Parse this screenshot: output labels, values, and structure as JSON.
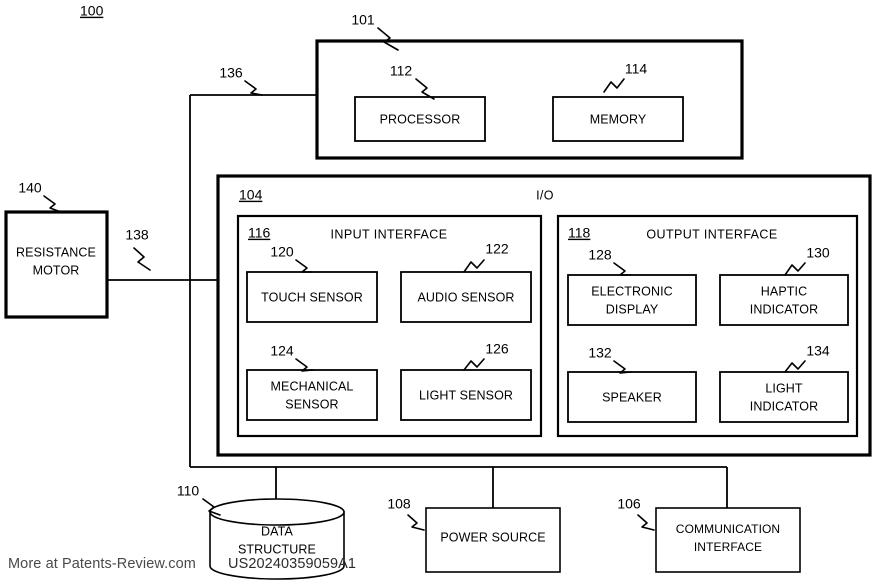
{
  "figure": {
    "id": "100",
    "io_title": "I/O",
    "blocks": {
      "system": {
        "ref": "101"
      },
      "processor": {
        "ref": "112",
        "label": "PROCESSOR"
      },
      "memory": {
        "ref": "114",
        "label": "MEMORY"
      },
      "io": {
        "ref": "104",
        "label": "I/O"
      },
      "input_interface": {
        "ref": "116",
        "label": "INPUT INTERFACE"
      },
      "output_interface": {
        "ref": "118",
        "label": "OUTPUT INTERFACE"
      },
      "touch_sensor": {
        "ref": "120",
        "label": "TOUCH SENSOR"
      },
      "audio_sensor": {
        "ref": "122",
        "label": "AUDIO SENSOR"
      },
      "mechanical_sensor": {
        "ref": "124",
        "label_line1": "MECHANICAL",
        "label_line2": "SENSOR"
      },
      "light_sensor": {
        "ref": "126",
        "label": "LIGHT SENSOR"
      },
      "electronic_display": {
        "ref": "128",
        "label_line1": "ELECTRONIC",
        "label_line2": "DISPLAY"
      },
      "haptic_indicator": {
        "ref": "130",
        "label_line1": "HAPTIC",
        "label_line2": "INDICATOR"
      },
      "speaker": {
        "ref": "132",
        "label": "SPEAKER"
      },
      "light_indicator": {
        "ref": "134",
        "label_line1": "LIGHT",
        "label_line2": "INDICATOR"
      },
      "resistance_motor": {
        "ref": "140",
        "label_line1": "RESISTANCE",
        "label_line2": "MOTOR"
      },
      "data_structure": {
        "ref": "110",
        "label_line1": "DATA",
        "label_line2": "STRUCTURE"
      },
      "power_source": {
        "ref": "108",
        "label": "POWER SOURCE"
      },
      "communication_interface": {
        "ref": "106",
        "label_line1": "COMMUNICATION",
        "label_line2": "INTERFACE"
      }
    },
    "connectors": {
      "bus_136": "136",
      "motor_link_138": "138"
    }
  },
  "watermark": {
    "source_text": "More at Patents-Review.com",
    "publication_number": "US20240359059A1"
  }
}
